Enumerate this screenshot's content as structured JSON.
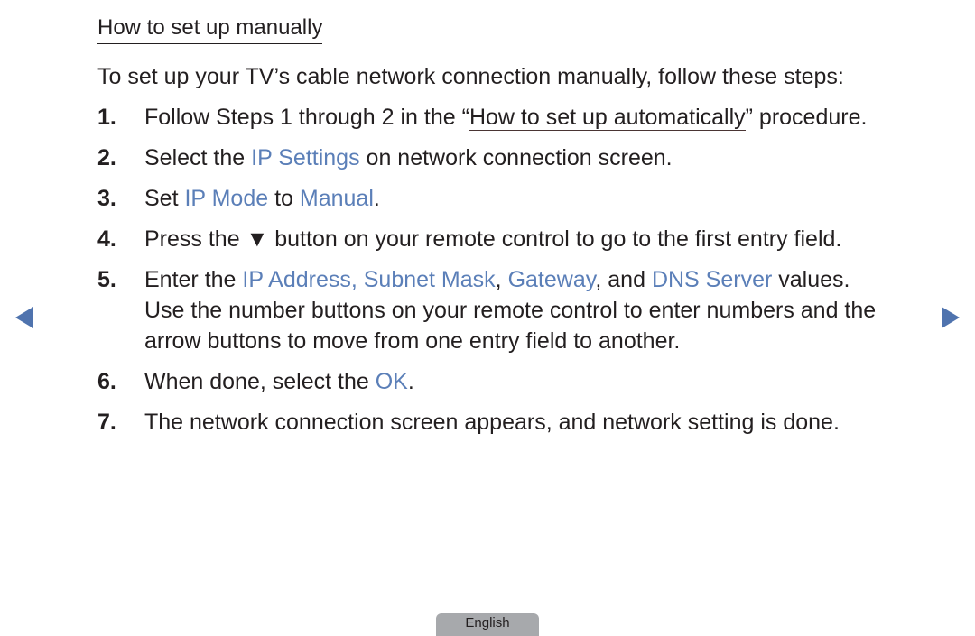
{
  "heading": "How to set up manually",
  "intro": "To set up your TV’s cable network connection manually, follow these steps:",
  "steps": [
    {
      "num": "1.",
      "parts": [
        {
          "t": "Follow Steps 1 through 2 in the “"
        },
        {
          "t": "How to set up automatically",
          "link": true
        },
        {
          "t": "” procedure."
        }
      ]
    },
    {
      "num": "2.",
      "parts": [
        {
          "t": "Select the "
        },
        {
          "t": "IP Settings",
          "hl": true
        },
        {
          "t": " on network connection screen."
        }
      ]
    },
    {
      "num": "3.",
      "parts": [
        {
          "t": "Set "
        },
        {
          "t": "IP Mode",
          "hl": true
        },
        {
          "t": " to "
        },
        {
          "t": "Manual",
          "hl": true
        },
        {
          "t": "."
        }
      ]
    },
    {
      "num": "4.",
      "parts": [
        {
          "t": "Press the ▼ button on your remote control to go to the first entry field."
        }
      ]
    },
    {
      "num": "5.",
      "parts": [
        {
          "t": "Enter the "
        },
        {
          "t": "IP Address, Subnet Mask",
          "hl": true
        },
        {
          "t": ", "
        },
        {
          "t": "Gateway",
          "hl": true
        },
        {
          "t": ", and "
        },
        {
          "t": "DNS Server",
          "hl": true
        },
        {
          "t": " values."
        }
      ],
      "continuation": [
        "Use the number buttons on your remote control to enter numbers and the",
        "arrow buttons to move from one entry field to another."
      ]
    },
    {
      "num": "6.",
      "parts": [
        {
          "t": "When done, select the "
        },
        {
          "t": "OK",
          "hl": true
        },
        {
          "t": "."
        }
      ]
    },
    {
      "num": "7.",
      "parts": [
        {
          "t": "The network connection screen appears, and network setting is done."
        }
      ]
    }
  ],
  "nav": {
    "prev_icon": "triangle-left",
    "next_icon": "triangle-right"
  },
  "language_tab": "English",
  "colors": {
    "highlight": "#5b7fb8",
    "arrow": "#4f73ae",
    "tab": "#a7a9ac"
  }
}
